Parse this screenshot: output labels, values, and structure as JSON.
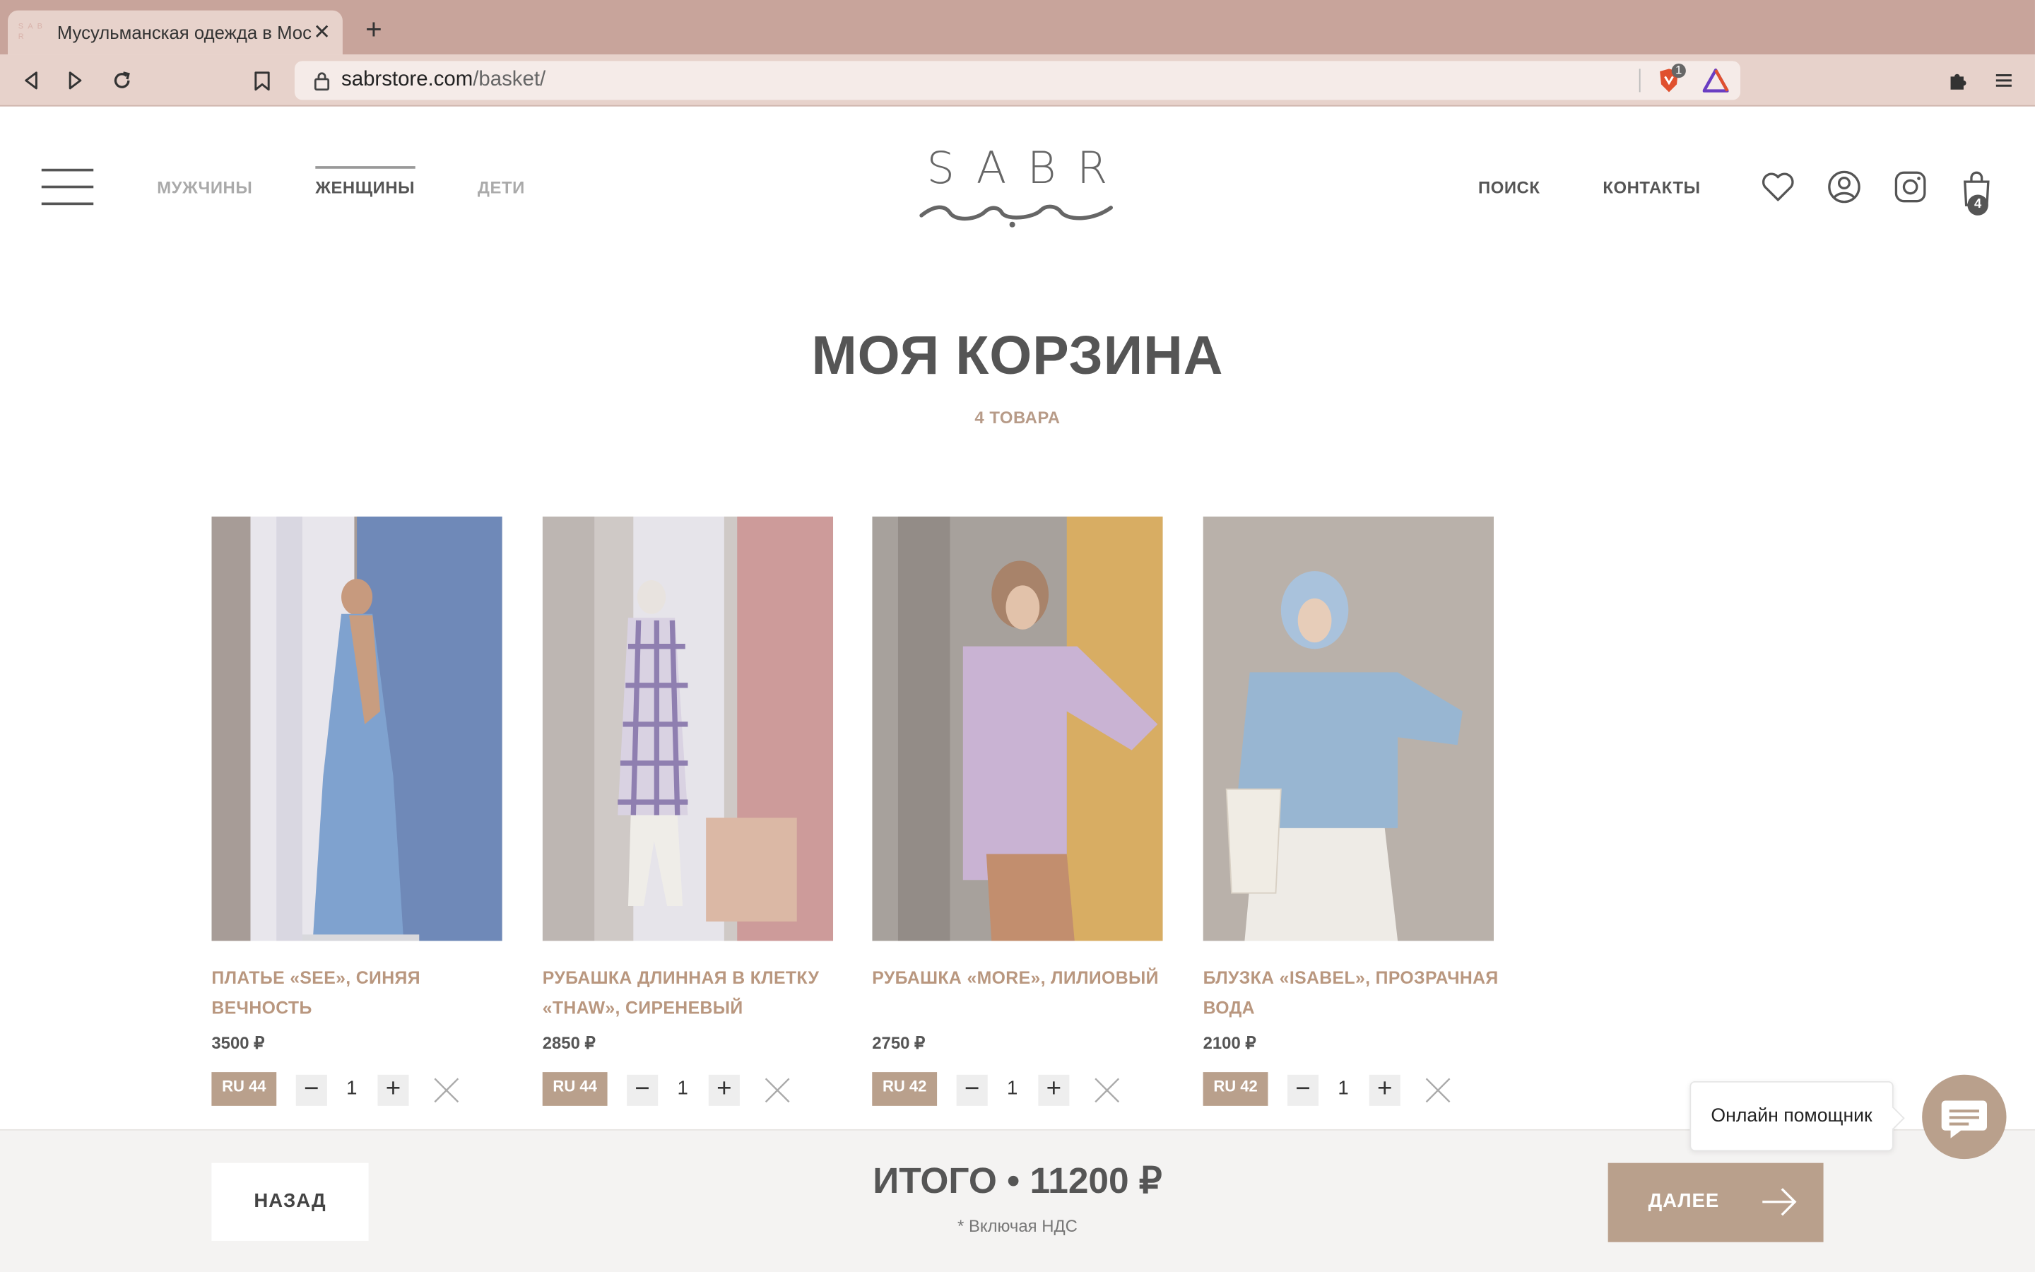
{
  "browser": {
    "tab_title": "Мусульманская одежда в Мос",
    "favicon_text": "S A B R",
    "url_domain": "sabrstore.com",
    "url_path": "/basket/",
    "shield_badge": "1"
  },
  "header": {
    "nav": [
      "МУЖЧИНЫ",
      "ЖЕНЩИНЫ",
      "ДЕТИ"
    ],
    "logo": "SABR",
    "search": "ПОИСК",
    "contacts": "КОНТАКТЫ",
    "cart_count": "4",
    "icons": [
      "heart-icon",
      "user-icon",
      "instagram-icon",
      "bag-icon"
    ]
  },
  "page": {
    "title": "МОЯ КОРЗИНА",
    "count": "4 ТОВАРА"
  },
  "products": [
    {
      "name": "ПЛАТЬЕ «SEE», СИНЯЯ ВЕЧНОСТЬ",
      "price": "3500 ₽",
      "size": "RU 44",
      "qty": "1"
    },
    {
      "name": "РУБАШКА ДЛИННАЯ В КЛЕТКУ «THAW», СИРЕНЕВЫЙ",
      "price": "2850 ₽",
      "size": "RU 44",
      "qty": "1"
    },
    {
      "name": "РУБАШКА «MORE», ЛИЛИОВЫЙ",
      "price": "2750 ₽",
      "size": "RU 42",
      "qty": "1"
    },
    {
      "name": "БЛУЗКА «ISABEL», ПРОЗРАЧНАЯ ВОДА",
      "price": "2100 ₽",
      "size": "RU 42",
      "qty": "1"
    }
  ],
  "footer": {
    "back": "НАЗАД",
    "total": "ИТОГО • 11200 ₽",
    "vat": "* Включая НДС",
    "next": "ДАЛЕЕ"
  },
  "chat": {
    "tooltip": "Онлайн помощник"
  },
  "colors": {
    "accent": "#b9a08c",
    "product_name": "#b9977f",
    "chrome": "#c8a49b"
  }
}
